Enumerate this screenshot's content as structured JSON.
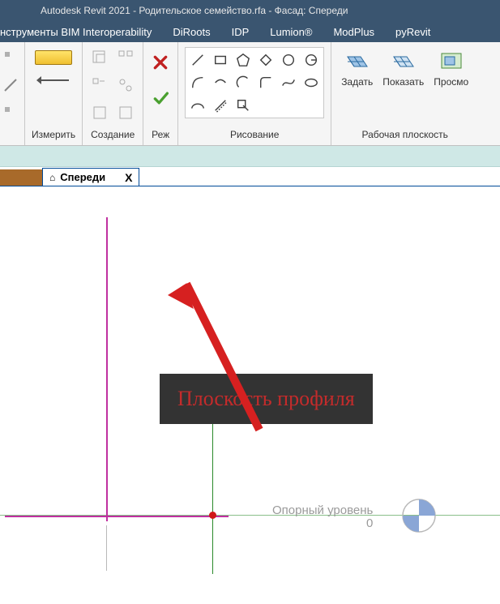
{
  "title": "Autodesk Revit 2021 - Родительское семейство.rfa - Фасад: Спереди",
  "menu": {
    "items": [
      "нструменты BIM Interoperability",
      "DiRoots",
      "IDP",
      "Lumion®",
      "ModPlus",
      "pyRevit"
    ]
  },
  "ribbon": {
    "measure": {
      "label": "Измерить"
    },
    "create": {
      "label": "Создание"
    },
    "mode": {
      "label": "Реж"
    },
    "draw": {
      "label": "Рисование"
    },
    "workplane": {
      "label": "Рабочая плоскость",
      "set": "Задать",
      "show": "Показать",
      "viewer": "Просмо"
    }
  },
  "view": {
    "tab_label": "Спереди",
    "close": "X"
  },
  "level": {
    "name": "Опорный уровень",
    "value": "0"
  },
  "annotation": "Плоскость профиля"
}
